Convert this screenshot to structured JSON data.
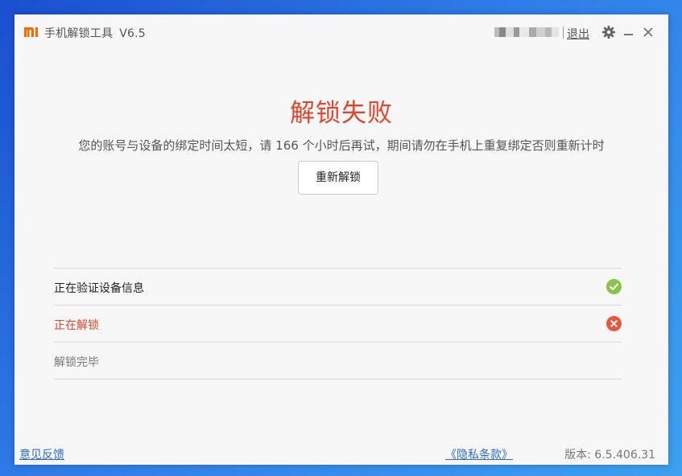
{
  "titlebar": {
    "app_name": "手机解锁工具",
    "version": "V6.5",
    "logout_label": "退出",
    "icons": [
      "mi-logo-icon",
      "gear-icon",
      "minimize-icon",
      "close-icon"
    ]
  },
  "result": {
    "title": "解锁失败",
    "message": "您的账号与设备的绑定时间太短，请 166 个小时后再试，期间请勿在手机上重复绑定否则重新计时",
    "retry_label": "重新解锁"
  },
  "steps": [
    {
      "label": "正在验证设备信息",
      "status": "done",
      "icon": "check-circle-icon"
    },
    {
      "label": "正在解锁",
      "status": "failed",
      "icon": "x-circle-icon"
    },
    {
      "label": "解锁完毕",
      "status": "pending",
      "icon": ""
    }
  ],
  "footer": {
    "feedback_label": "意见反馈",
    "privacy_label": "《隐私条款》",
    "version_text": "版本: 6.5.406.31"
  },
  "colors": {
    "accent_red": "#e0452e",
    "success_green": "#8bc34a",
    "link_blue": "#2f6cc7",
    "brand_orange": "#ff6700"
  }
}
